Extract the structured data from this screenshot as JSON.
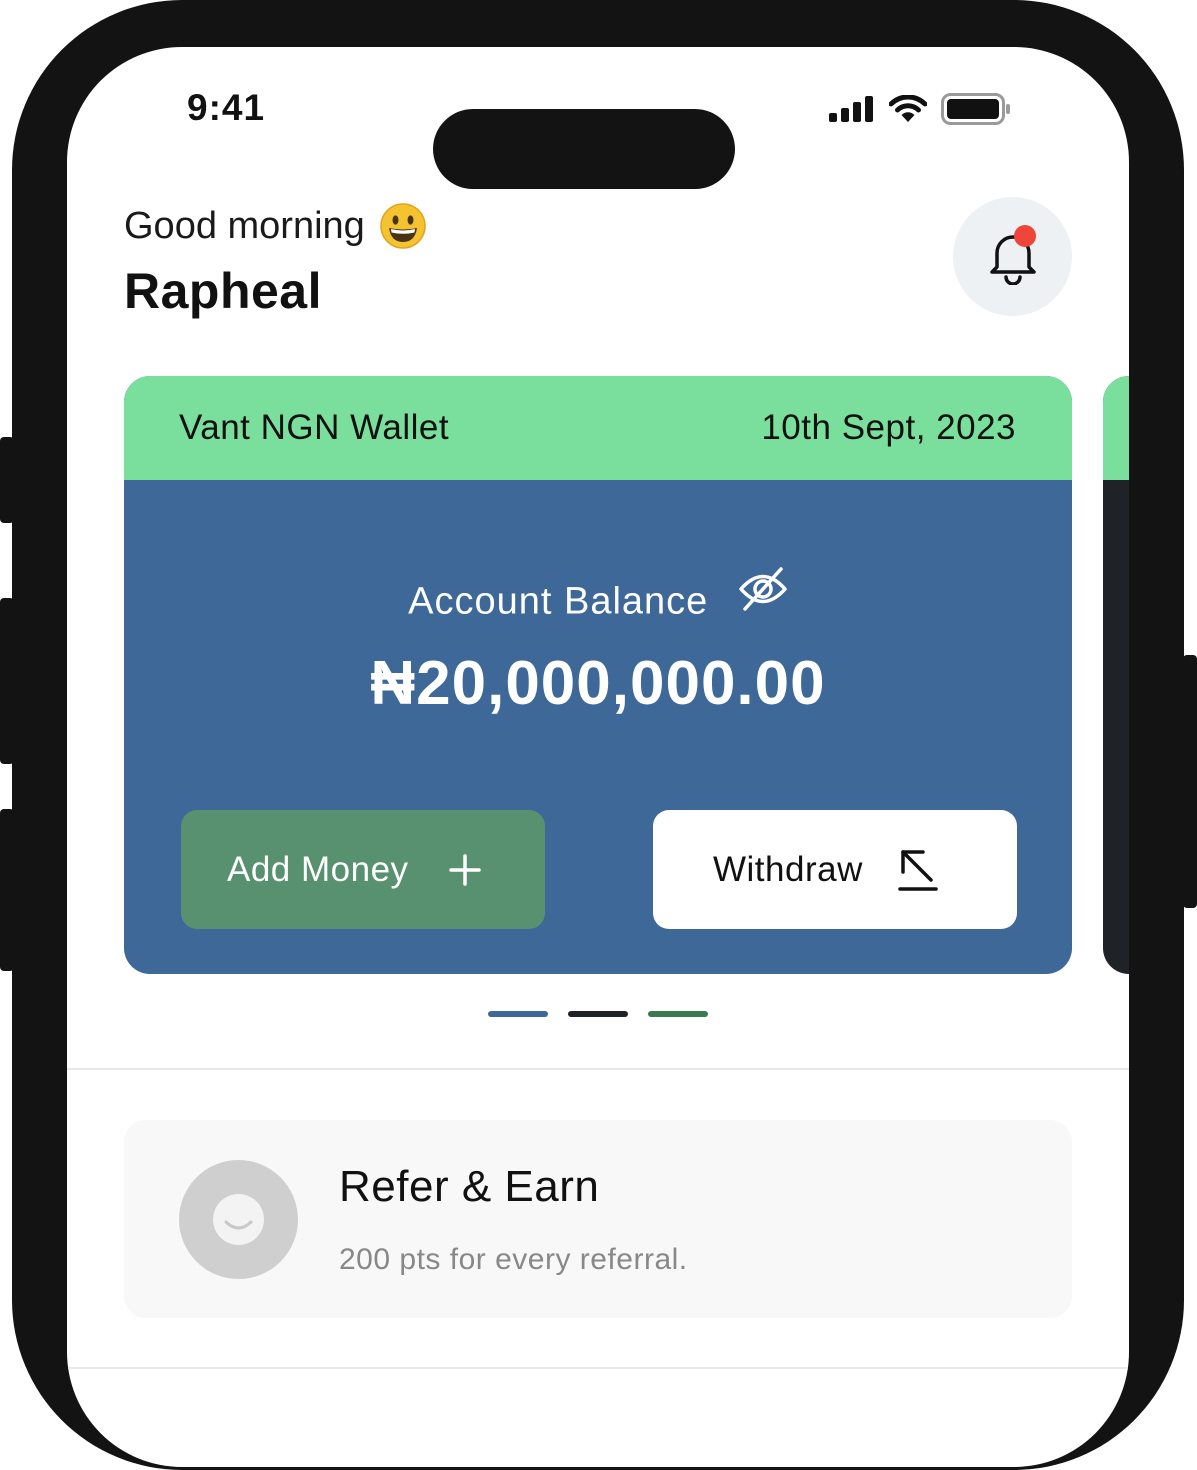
{
  "status_bar": {
    "time": "9:41"
  },
  "header": {
    "greeting": "Good morning",
    "greeting_emoji": "😀",
    "user_name": "Rapheal",
    "notification_icon": "bell-icon"
  },
  "wallet": {
    "name": "Vant NGN Wallet",
    "date": "10th Sept, 2023",
    "balance_label": "Account Balance",
    "balance": "₦20,000,000.00",
    "add_money_label": "Add Money",
    "withdraw_label": "Withdraw"
  },
  "carousel": {
    "page_count": 3,
    "active_index": 0,
    "dot_colors": [
      "#3d6897",
      "#1f2328",
      "#3a7a50"
    ]
  },
  "referral": {
    "title": "Refer & Earn",
    "subtitle": "200 pts for every referral."
  },
  "colors": {
    "wallet_header": "#7ade9c",
    "wallet_body": "#3d6897",
    "add_money_bg": "#58916f",
    "notification_dot": "#f0453a"
  }
}
